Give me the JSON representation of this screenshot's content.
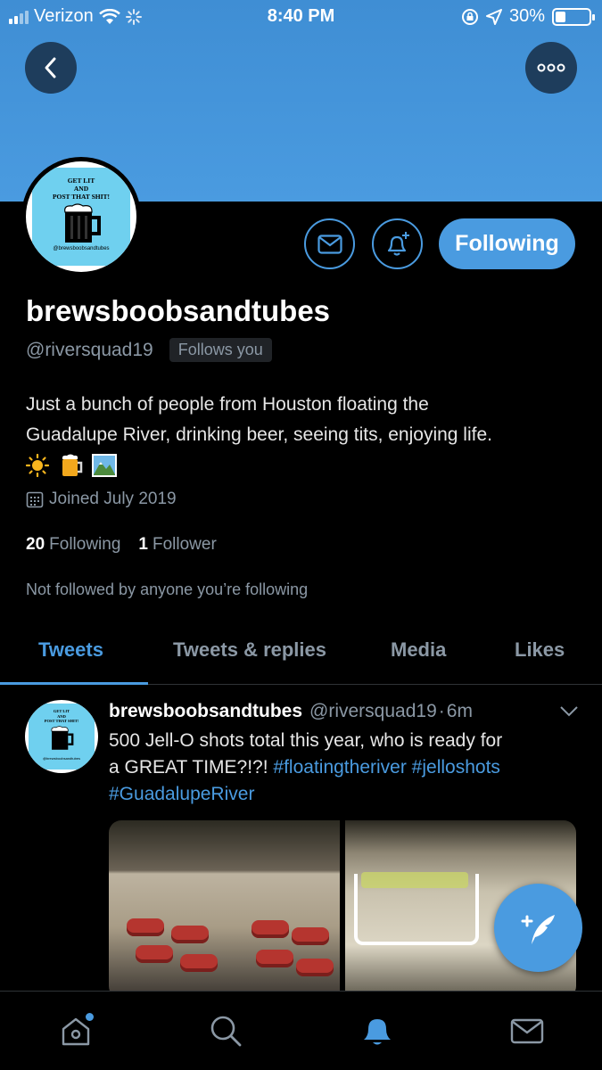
{
  "status_bar": {
    "carrier": "Verizon",
    "time": "8:40 PM",
    "battery": "30%"
  },
  "logo": {
    "text": "GET LIT\nAND\nPOST THAT SHIT!",
    "handle_text": "@brewsboobsandtubes"
  },
  "profile": {
    "display_name": "brewsboobsandtubes",
    "handle": "@riversquad19",
    "follows_you": "Follows you",
    "following_button": "Following",
    "bio_line1": "Just a bunch of people from Houston floating the",
    "bio_line2": "Guadalupe River, drinking beer, seeing tits, enjoying life.",
    "bio_emojis": [
      "sun-emoji",
      "beer-emoji",
      "mountain-emoji"
    ],
    "joined": "Joined July 2019",
    "following_count": "20",
    "following_label": "Following",
    "followers_count": "1",
    "followers_label": "Follower",
    "not_followed": "Not followed by anyone you’re following"
  },
  "tabs": [
    {
      "label": "Tweets",
      "active": true
    },
    {
      "label": "Tweets & replies",
      "active": false
    },
    {
      "label": "Media",
      "active": false
    },
    {
      "label": "Likes",
      "active": false
    }
  ],
  "tweet": {
    "name": "brewsboobsandtubes",
    "handle": "@riversquad19",
    "separator": "·",
    "time": "6m",
    "text_line1": "500 Jell-O shots total this year, who is ready for",
    "text_line2_plain": "a GREAT TIME?!?!",
    "hashtag1": "#floatingtheriver",
    "hashtag2": "#jelloshots",
    "hashtag3": "#GuadalupeRiver"
  },
  "bottom_nav": [
    {
      "icon": "home-icon",
      "active": false,
      "badge": true
    },
    {
      "icon": "search-icon",
      "active": false
    },
    {
      "icon": "bell-icon",
      "active": true
    },
    {
      "icon": "mail-icon",
      "active": false
    }
  ],
  "colors": {
    "accent": "#4a9be0",
    "banner": "#4a9be0",
    "background": "#000000",
    "secondary_text": "#8b98a5"
  }
}
